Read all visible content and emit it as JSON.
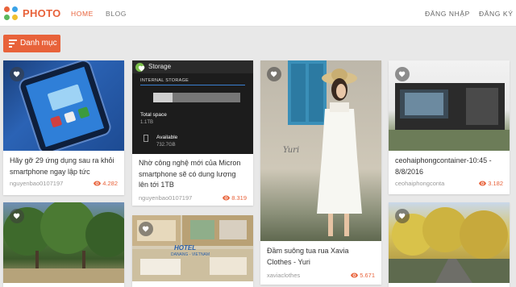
{
  "header": {
    "brand": "PHOTO",
    "nav": [
      {
        "label": "HOME",
        "active": true
      },
      {
        "label": "BLOG",
        "active": false
      }
    ],
    "login": "ĐĂNG NHẬP",
    "register": "ĐĂNG KÝ",
    "brand_color": "#e8623a"
  },
  "category_button": {
    "label": "Danh mục",
    "icon": "menu-lines-icon"
  },
  "cards": [
    {
      "title": "Hãy gỡ 29 ứng dụng sau ra khỏi smartphone ngay lập tức",
      "author": "nguyenbao0107197",
      "views": "4.282"
    },
    {
      "title": "Nhờ công nghệ mới của Micron smartphone sẽ có dung lượng lên tới 1TB",
      "author": "nguyenbao0107197",
      "views": "8.319",
      "screen": {
        "header": "Storage",
        "section": "INTERNAL STORAGE",
        "total_label": "Total space",
        "total_value": "1.1TB",
        "avail_label": "Available",
        "avail_value": "732.7GB"
      }
    },
    {
      "title": "Đầm suông tua rua Xavia Clothes - Yuri",
      "author": "xaviaclothes",
      "views": "5.671",
      "watermark": "Yuri"
    },
    {
      "title": "ceohaiphongcontainer-10:45 - 8/8/2016",
      "author": "ceohaiphongconta",
      "views": "3.182"
    },
    {
      "title": "",
      "author": "",
      "views": ""
    },
    {
      "title": "",
      "author": "",
      "views": "",
      "hotel_name": "HOTEL",
      "hotel_city": "DANANG - VIETNAM"
    },
    {
      "title": "",
      "author": "",
      "views": ""
    }
  ]
}
